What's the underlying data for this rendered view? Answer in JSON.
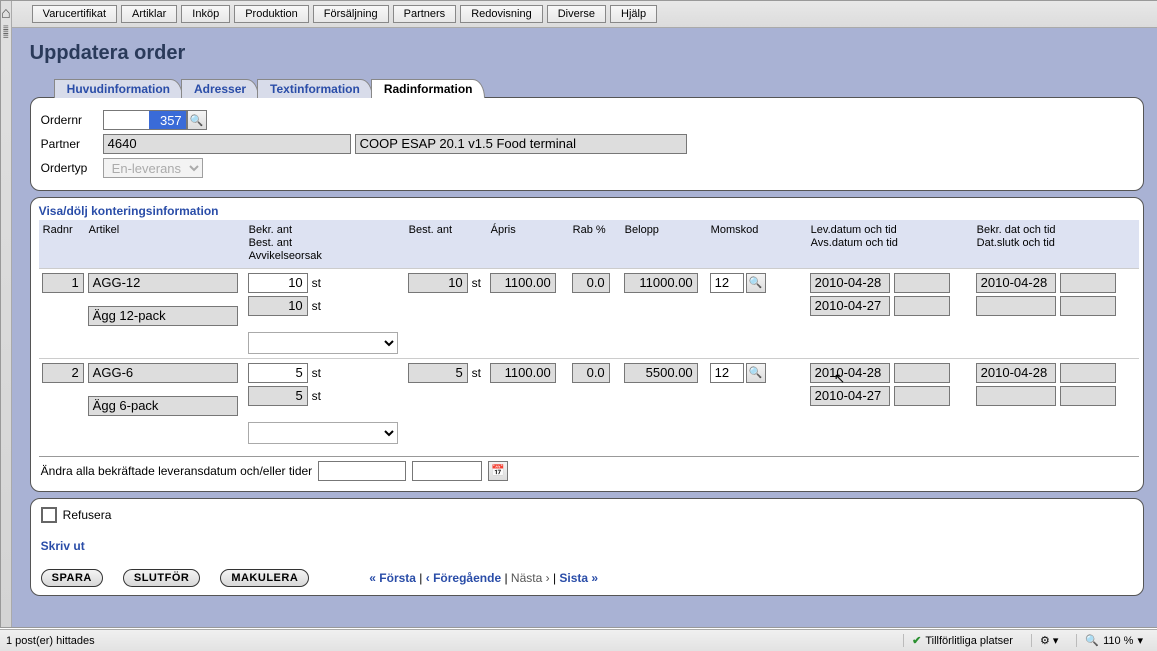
{
  "menu": [
    "Varucertifikat",
    "Artiklar",
    "Inköp",
    "Produktion",
    "Försäljning",
    "Partners",
    "Redovisning",
    "Diverse",
    "Hjälp"
  ],
  "page_title": "Uppdatera order",
  "tabs": [
    "Huvudinformation",
    "Adresser",
    "Textinformation",
    "Radinformation"
  ],
  "active_tab_index": 3,
  "header": {
    "ordernr_label": "Ordernr",
    "ordernr_value": "357",
    "partner_label": "Partner",
    "partner_code": "4640",
    "partner_name": "COOP ESAP 20.1 v1.5 Food terminal",
    "ordertyp_label": "Ordertyp",
    "ordertyp_value": "En-leverans"
  },
  "grid": {
    "toggle_link": "Visa/dölj konteringsinformation",
    "columns": {
      "radnr": "Radnr",
      "artikel": "Artikel",
      "bekr": "Bekr. ant\nBest. ant\nAvvikelseorsak",
      "best_ant": "Best. ant",
      "apris": "Ápris",
      "rab": "Rab %",
      "belopp": "Belopp",
      "momskod": "Momskod",
      "lev": "Lev.datum och tid\nAvs.datum och tid",
      "bekrdat": "Bekr. dat och tid\nDat.slutk och tid"
    },
    "rows": [
      {
        "radnr": "1",
        "artikel_code": "AGG-12",
        "artikel_desc": "Ägg 12-pack",
        "bekr_ant": "10",
        "best_ant_small": "10",
        "unit": "st",
        "best_ant": "10",
        "apris": "1100.00",
        "rab": "0.0",
        "belopp": "11000.00",
        "momskod": "12",
        "lev_date1": "2010-04-28",
        "lev_date2": "2010-04-27",
        "bekr_date1": "2010-04-28"
      },
      {
        "radnr": "2",
        "artikel_code": "AGG-6",
        "artikel_desc": "Ägg 6-pack",
        "bekr_ant": "5",
        "best_ant_small": "5",
        "unit": "st",
        "best_ant": "5",
        "apris": "1100.00",
        "rab": "0.0",
        "belopp": "5500.00",
        "momskod": "12",
        "lev_date1": "2010-04-28",
        "lev_date2": "2010-04-27",
        "bekr_date1": "2010-04-28"
      }
    ],
    "footer_label": "Ändra alla bekräftade leveransdatum och/eller tider"
  },
  "refusera_label": "Refusera",
  "skriv_ut": "Skriv ut",
  "buttons": {
    "spara": "SPARA",
    "slutfor": "SLUTFÖR",
    "makulera": "MAKULERA"
  },
  "pager": {
    "first": "« Första",
    "prev": "‹ Föregående",
    "next": "Nästa ›",
    "last": "Sista »"
  },
  "status": {
    "left": "1 post(er) hittades",
    "trusted": "Tillförlitliga platser",
    "zoom": "110 %"
  }
}
